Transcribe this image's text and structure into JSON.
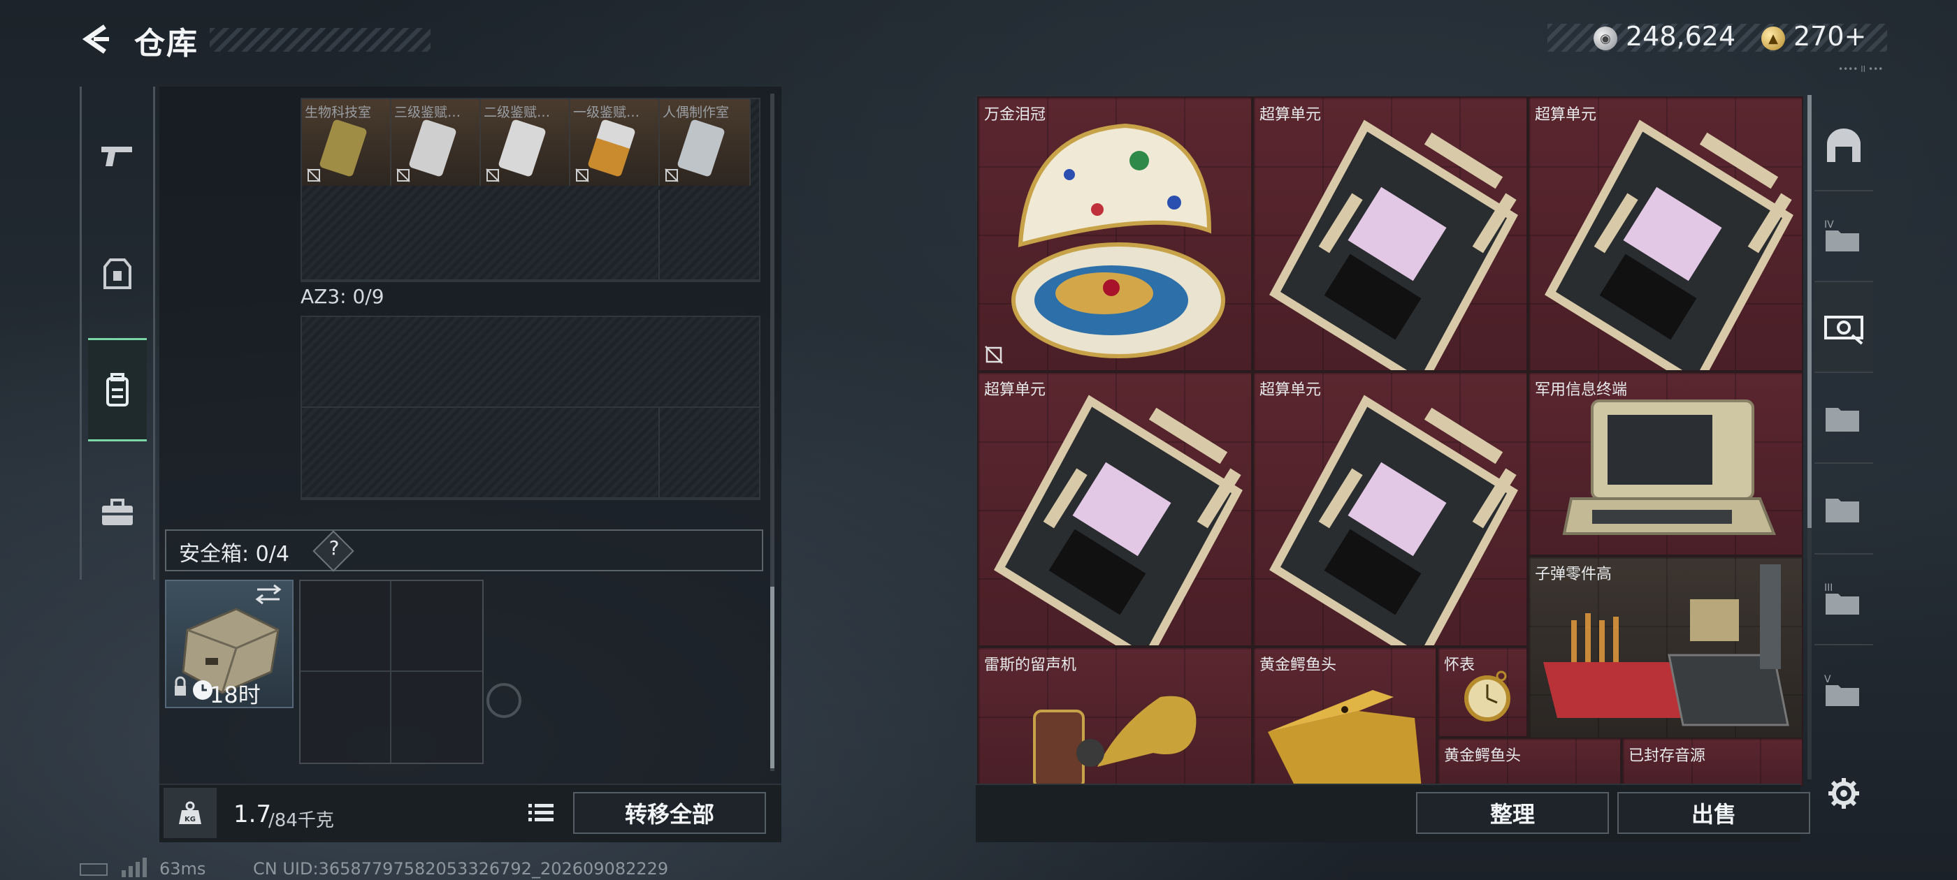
{
  "header": {
    "title": "仓库",
    "silver_amount": "248,624",
    "gold_amount": "270+",
    "corner_label": "•••• II •••"
  },
  "left_sidebar": {
    "tabs": [
      {
        "icon": "gun-icon",
        "active": false
      },
      {
        "icon": "armor-icon",
        "active": false
      },
      {
        "icon": "backpack-icon",
        "active": true
      },
      {
        "icon": "toolbox-icon",
        "active": false
      }
    ]
  },
  "left_panel": {
    "top_items": [
      {
        "label": "生物科技室",
        "color": "#b9a55a"
      },
      {
        "label": "三级鉴赋…",
        "color": "#c9c9c9"
      },
      {
        "label": "二级鉴赋…",
        "color": "#d7d7d7"
      },
      {
        "label": "一级鉴赋…",
        "color": "#c98b2e"
      },
      {
        "label": "人偶制作室",
        "color": "#bfc4c8"
      }
    ],
    "az3_label": "AZ3: 0/9",
    "safebox_label": "安全箱: 0/4",
    "safebox_help": "?",
    "safebox_time": "18时",
    "weight_value": "1.7",
    "weight_max": "/84千克",
    "transfer_label": "转移全部"
  },
  "stash": {
    "items": [
      {
        "name": "万金泪冠",
        "kind": "egg"
      },
      {
        "name": "超算单元",
        "kind": "board"
      },
      {
        "name": "超算单元",
        "kind": "board"
      },
      {
        "name": "超算单元",
        "kind": "board"
      },
      {
        "name": "超算单元",
        "kind": "board"
      },
      {
        "name": "军用信息终端",
        "kind": "terminal"
      },
      {
        "name": "子弹零件高",
        "kind": "bullets"
      },
      {
        "name": "雷斯的留声机",
        "kind": "phonograph"
      },
      {
        "name": "黄金鳄鱼头",
        "kind": "croc"
      },
      {
        "name": "怀表",
        "kind": "watch"
      },
      {
        "name": "黄金鳄鱼头",
        "kind": "croc"
      },
      {
        "name": "已封存音源",
        "kind": "sealed"
      }
    ],
    "sort_label": "整理",
    "sell_label": "出售"
  },
  "right_rail": {
    "icons": [
      "gate-icon",
      "level-iv-folder-icon",
      "cash-icon",
      "folder-icon",
      "folder-icon",
      "level-iii-folder-icon",
      "level-v-folder-icon"
    ]
  },
  "footer": {
    "ping": "63ms",
    "uid": "CN UID:36587797582053326792_202609082229"
  },
  "colors": {
    "accent_green": "#7bd6a6",
    "stash_cell": "#5a262f",
    "panel_bg": "#1c2024"
  }
}
